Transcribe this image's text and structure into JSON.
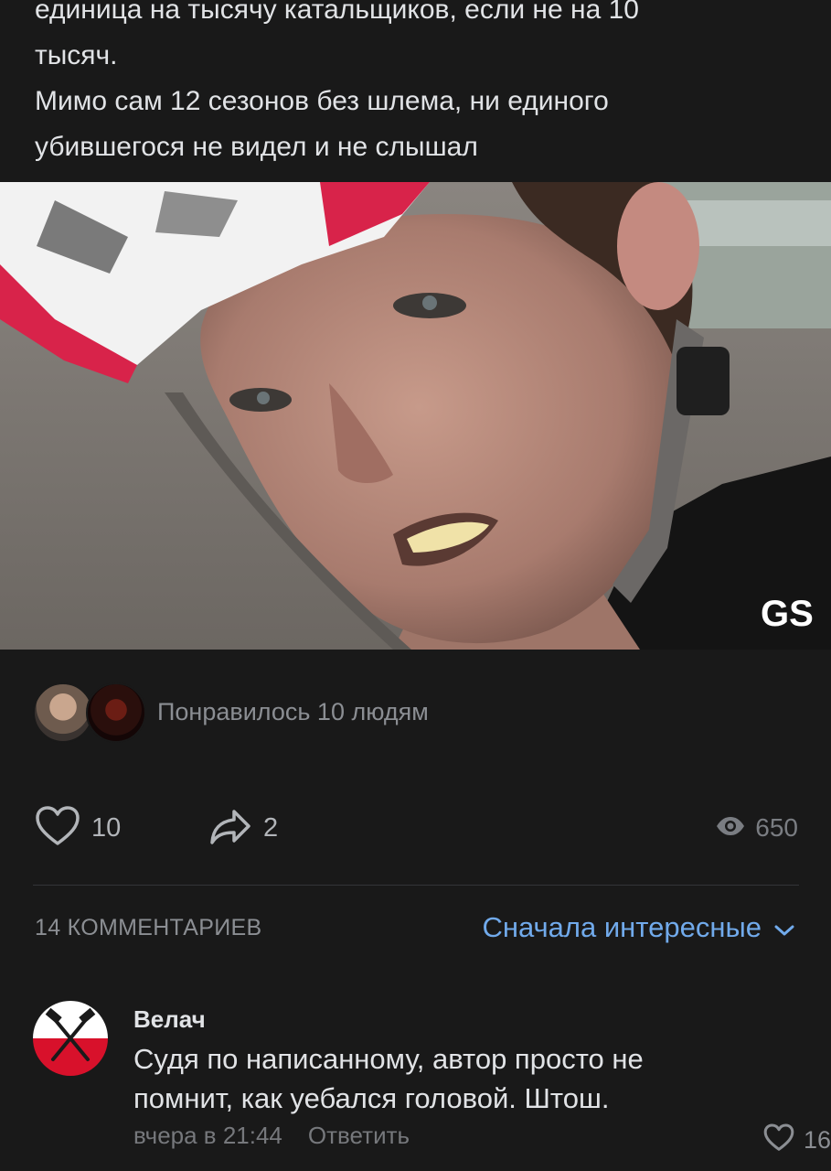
{
  "post": {
    "text_lines": [
      "единица на тысячу катальщиков, если не на 10",
      "тысяч.",
      "Мимо сам 12 сезонов без шлема, ни единого",
      "убившегося не видел и не слышал"
    ],
    "image_watermark": "GS"
  },
  "likers": {
    "text": "Понравилось 10 людям"
  },
  "actions": {
    "likes": "10",
    "shares": "2",
    "views": "650"
  },
  "comments_header": {
    "count_label": "14 КОММЕНТАРИЕВ",
    "sort_label": "Сначала интересные"
  },
  "comment": {
    "author": "Велач",
    "text_line1": "Судя по написанному, автор просто не",
    "text_line2": "помнит, как уебался головой. Штош.",
    "time": "вчера в 21:44",
    "reply_label": "Ответить",
    "likes": "16"
  },
  "colors": {
    "accent": "#71aaeb",
    "background": "#191919",
    "text": "#e1e3e6",
    "muted": "#8b8e93"
  }
}
